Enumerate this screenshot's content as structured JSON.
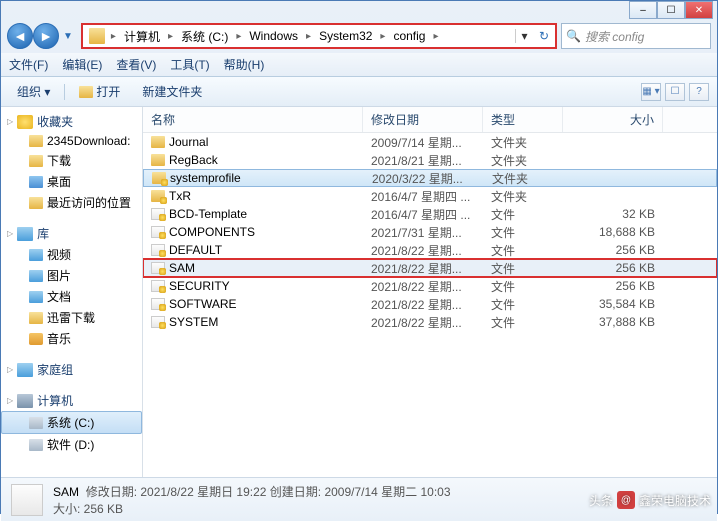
{
  "window": {
    "controls": {
      "min": "–",
      "max": "☐",
      "close": "✕"
    }
  },
  "nav": {
    "back": "◄",
    "fwd": "►",
    "drop": "▼",
    "refresh": "↻"
  },
  "breadcrumb": {
    "items": [
      "计算机",
      "系统 (C:)",
      "Windows",
      "System32",
      "config"
    ]
  },
  "search": {
    "placeholder": "搜索 config"
  },
  "menu": {
    "file": "文件(F)",
    "edit": "编辑(E)",
    "view": "查看(V)",
    "tools": "工具(T)",
    "help": "帮助(H)"
  },
  "toolbar": {
    "organize": "组织 ▾",
    "open": "打开",
    "newfolder": "新建文件夹",
    "views": "▦ ▾",
    "help": "?"
  },
  "sidebar": {
    "favorites": {
      "label": "收藏夹",
      "items": [
        {
          "label": "2345Download:"
        },
        {
          "label": "下载"
        },
        {
          "label": "桌面"
        },
        {
          "label": "最近访问的位置"
        }
      ]
    },
    "libraries": {
      "label": "库",
      "items": [
        {
          "label": "视频"
        },
        {
          "label": "图片"
        },
        {
          "label": "文档"
        },
        {
          "label": "迅雷下载"
        },
        {
          "label": "音乐"
        }
      ]
    },
    "homegroup": {
      "label": "家庭组"
    },
    "computer": {
      "label": "计算机",
      "items": [
        {
          "label": "系统 (C:)",
          "selected": true
        },
        {
          "label": "软件 (D:)"
        }
      ]
    }
  },
  "columns": {
    "name": "名称",
    "date": "修改日期",
    "type": "类型",
    "size": "大小"
  },
  "files": [
    {
      "name": "Journal",
      "date": "2009/7/14 星期...",
      "type": "文件夹",
      "size": "",
      "icon": "folder"
    },
    {
      "name": "RegBack",
      "date": "2021/8/21 星期...",
      "type": "文件夹",
      "size": "",
      "icon": "folder"
    },
    {
      "name": "systemprofile",
      "date": "2020/3/22 星期...",
      "type": "文件夹",
      "size": "",
      "icon": "lfolder",
      "sel": true
    },
    {
      "name": "TxR",
      "date": "2016/4/7 星期四 ...",
      "type": "文件夹",
      "size": "",
      "icon": "lfolder"
    },
    {
      "name": "BCD-Template",
      "date": "2016/4/7 星期四 ...",
      "type": "文件",
      "size": "32 KB",
      "icon": "file"
    },
    {
      "name": "COMPONENTS",
      "date": "2021/7/31 星期...",
      "type": "文件",
      "size": "18,688 KB",
      "icon": "file"
    },
    {
      "name": "DEFAULT",
      "date": "2021/8/22 星期...",
      "type": "文件",
      "size": "256 KB",
      "icon": "file"
    },
    {
      "name": "SAM",
      "date": "2021/8/22 星期...",
      "type": "文件",
      "size": "256 KB",
      "icon": "file",
      "hl": true
    },
    {
      "name": "SECURITY",
      "date": "2021/8/22 星期...",
      "type": "文件",
      "size": "256 KB",
      "icon": "file"
    },
    {
      "name": "SOFTWARE",
      "date": "2021/8/22 星期...",
      "type": "文件",
      "size": "35,584 KB",
      "icon": "file"
    },
    {
      "name": "SYSTEM",
      "date": "2021/8/22 星期...",
      "type": "文件",
      "size": "37,888 KB",
      "icon": "file"
    }
  ],
  "status": {
    "name": "SAM",
    "line1": "修改日期: 2021/8/22 星期日 19:22  创建日期: 2009/7/14 星期二 10:03",
    "line2": "大小: 256 KB"
  },
  "watermark": {
    "prefix": "头条",
    "at": "@",
    "text": "鑫荣电脑技术"
  }
}
